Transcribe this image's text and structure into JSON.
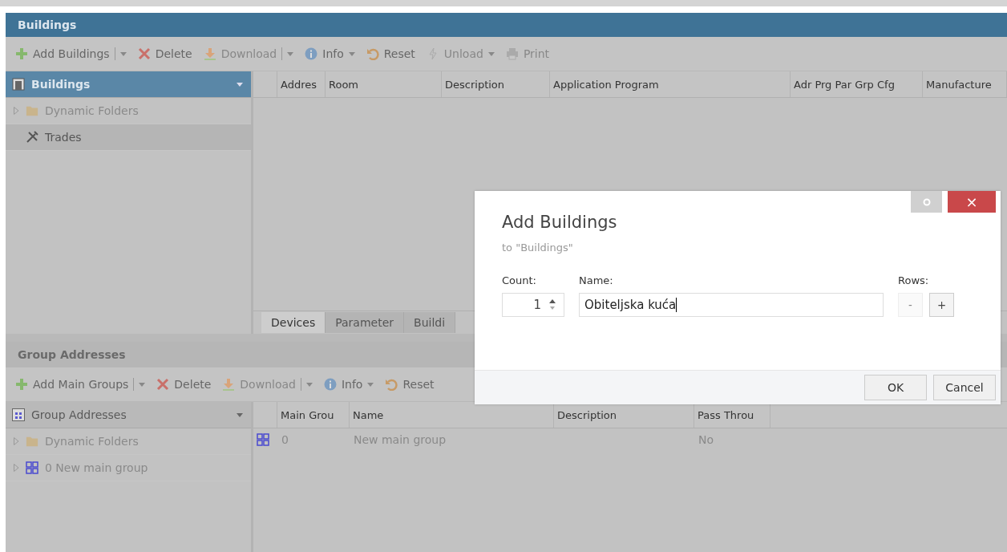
{
  "window": {
    "title": "Buildings"
  },
  "toolbar": [
    {
      "kind": "add",
      "label": "Add Buildings",
      "split": true,
      "disabled": false
    },
    {
      "kind": "delete",
      "label": "Delete",
      "split": false,
      "disabled": false
    },
    {
      "kind": "download",
      "label": "Download",
      "split": true,
      "disabled": true
    },
    {
      "kind": "info",
      "label": "Info",
      "split": false,
      "menu": true,
      "disabled": false
    },
    {
      "kind": "reset",
      "label": "Reset",
      "split": false,
      "disabled": false
    },
    {
      "kind": "unload",
      "label": "Unload",
      "split": false,
      "menu": true,
      "disabled": true
    },
    {
      "kind": "print",
      "label": "Print",
      "split": false,
      "disabled": true
    }
  ],
  "tree": {
    "header": "Buildings",
    "items": [
      {
        "kind": "folder",
        "label": "Dynamic Folders",
        "expandable": true,
        "selected": false
      },
      {
        "kind": "trades",
        "label": "Trades",
        "expandable": false,
        "selected": true
      }
    ]
  },
  "table": {
    "columns": [
      "Addres",
      "Room",
      "Description",
      "Application Program",
      "Adr Prg Par Grp Cfg",
      "Manufacture"
    ]
  },
  "tabs": [
    {
      "label": "Devices",
      "selected": true
    },
    {
      "label": "Parameter",
      "selected": false
    },
    {
      "label": "Buildi",
      "selected": false
    }
  ],
  "group_addresses": {
    "title": "Group Addresses",
    "toolbar": [
      {
        "kind": "add",
        "label": "Add Main Groups",
        "split": true,
        "disabled": false
      },
      {
        "kind": "delete",
        "label": "Delete",
        "split": false,
        "disabled": false
      },
      {
        "kind": "download",
        "label": "Download",
        "split": true,
        "disabled": true
      },
      {
        "kind": "info",
        "label": "Info",
        "split": false,
        "menu": true,
        "disabled": false
      },
      {
        "kind": "reset",
        "label": "Reset",
        "split": false,
        "disabled": false
      }
    ],
    "tree": {
      "header": "Group Addresses",
      "items": [
        {
          "kind": "folder",
          "label": "Dynamic Folders",
          "expandable": true,
          "selected": false
        },
        {
          "kind": "group",
          "label": "0 New main group",
          "expandable": true,
          "selected": false
        }
      ]
    },
    "table": {
      "columns": [
        "Main Grou",
        "Name",
        "Description",
        "Pass Throu"
      ],
      "rows": [
        [
          "0",
          "New main group",
          "",
          "No"
        ]
      ]
    }
  },
  "dialog": {
    "title": "Add Buildings",
    "subtitle": "to \"Buildings\"",
    "count_label": "Count:",
    "count": "1",
    "name_label": "Name:",
    "name": "Obiteljska kuća",
    "rows_label": "Rows:",
    "minus": "-",
    "minus_disabled": true,
    "plus": "+",
    "close": "×",
    "buttons": [
      "OK",
      "Cancel"
    ]
  }
}
